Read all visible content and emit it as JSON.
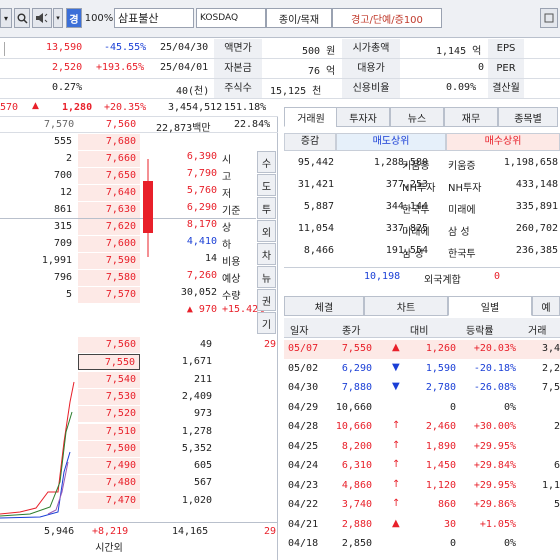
{
  "toolbar": {
    "search_icon": "search-icon",
    "sound_icon": "speaker-icon",
    "mode_label": "경",
    "pct_label": "100%",
    "stock_name": "삼표불산",
    "market": "KOSDAQ",
    "sector": "종이/목재",
    "warning": "경고/단예/증100"
  },
  "info": {
    "row1": {
      "val1": "13,590",
      "chg": "-45.55%",
      "date": "25/04/30",
      "label1": "액면가",
      "face": "500 원",
      "label2": "시가총액",
      "cap": "1,145 억",
      "label3": "EPS"
    },
    "row2": {
      "val1": "2,520",
      "chg": "+193.65%",
      "date": "25/04/01",
      "label1": "자본금",
      "face": "76 억",
      "label2": "대용가",
      "cap": "0",
      "label3": "PER"
    },
    "row3": {
      "val1": "0.27%",
      "date": "40(천)",
      "label1": "주식수",
      "face": "15,125 천",
      "label2": "신용비율",
      "cap": "0.09%",
      "label3": "결산월"
    }
  },
  "quote": {
    "prev": "570",
    "price": "1,280",
    "pct": "+20.35%",
    "volume": "3,454,512",
    "turnover": "151.18%"
  },
  "orderbook": {
    "header_left": "7,570",
    "header_price": "7,560",
    "amount": "22,873백만",
    "amount_pct": "22.84%",
    "sell": [
      {
        "qty": "555",
        "price": "7,680"
      },
      {
        "qty": "2",
        "price": "7,660"
      },
      {
        "qty": "700",
        "price": "7,650"
      },
      {
        "qty": "12",
        "price": "7,640"
      },
      {
        "qty": "861",
        "price": "7,630"
      },
      {
        "qty": "315",
        "price": "7,620"
      },
      {
        "qty": "709",
        "price": "7,600"
      },
      {
        "qty": "1,991",
        "price": "7,590"
      },
      {
        "qty": "796",
        "price": "7,580"
      },
      {
        "qty": "5",
        "price": "7,570"
      }
    ],
    "info_side": [
      {
        "val": "6,390",
        "lbl": "시"
      },
      {
        "val": "7,790",
        "lbl": "고"
      },
      {
        "val": "5,760",
        "lbl": "저"
      },
      {
        "val": "6,290",
        "lbl": "기준"
      },
      {
        "val": "8,170",
        "lbl": "상"
      },
      {
        "val": "4,410",
        "lbl": "하"
      },
      {
        "val": "14",
        "lbl": "비용"
      },
      {
        "val": "7,260",
        "lbl": "예상"
      },
      {
        "val": "30,052",
        "lbl": "수량"
      },
      {
        "val": "▲ 970",
        "lbl": "+15.42%"
      }
    ],
    "vtabs": [
      "수",
      "도",
      "투",
      "외",
      "차",
      "뉴",
      "권",
      "기"
    ],
    "buy": [
      {
        "price": "7,560",
        "qty": "49",
        "right": "29"
      },
      {
        "price": "7,550",
        "qty": "1,671",
        "right": ""
      },
      {
        "price": "7,540",
        "qty": "211",
        "right": ""
      },
      {
        "price": "7,530",
        "qty": "2,409",
        "right": ""
      },
      {
        "price": "7,520",
        "qty": "973",
        "right": ""
      },
      {
        "price": "7,510",
        "qty": "1,278",
        "right": ""
      },
      {
        "price": "7,500",
        "qty": "5,352",
        "right": ""
      },
      {
        "price": "7,490",
        "qty": "605",
        "right": ""
      },
      {
        "price": "7,480",
        "qty": "567",
        "right": ""
      },
      {
        "price": "7,470",
        "qty": "1,020",
        "right": ""
      }
    ],
    "foot": {
      "left": "5,946",
      "mid": "+8,219",
      "right": "14,165",
      "rr": "29",
      "label": "시간외"
    }
  },
  "right_tabs": [
    "거래원",
    "투자자",
    "뉴스",
    "재무",
    "종목별"
  ],
  "broker": {
    "head": [
      "증감",
      "매도상위",
      "매수상위"
    ],
    "rows": [
      {
        "chg": "95,442",
        "sv": "1,288,580",
        "sn": "키움증",
        "bn": "키움증",
        "bv": "1,198,658"
      },
      {
        "chg": "31,421",
        "sv": "377,253",
        "sn": "NH투자",
        "bn": "NH투자",
        "bv": "433,148"
      },
      {
        "chg": "5,887",
        "sv": "344,144",
        "sn": "한국투",
        "bn": "미래에",
        "bv": "335,891"
      },
      {
        "chg": "11,054",
        "sv": "337,825",
        "sn": "미래에",
        "bn": "삼 성",
        "bv": "260,702"
      },
      {
        "chg": "8,466",
        "sv": "191,554",
        "sn": "삼 성",
        "bn": "한국투",
        "bv": "236,385"
      }
    ],
    "foreign": {
      "val": "10,198",
      "label": "외국계합",
      "right": "0"
    }
  },
  "lower_tabs": [
    "체결",
    "차트",
    "일별",
    "예"
  ],
  "daily": {
    "head": [
      "일자",
      "종가",
      "대비",
      "등락률",
      "거래"
    ],
    "rows": [
      {
        "d": "05/07",
        "close": "7,550",
        "dir": "▲",
        "diff": "1,260",
        "rate": "+20.03%",
        "vol": "3,4",
        "color": "red",
        "hl": true
      },
      {
        "d": "05/02",
        "close": "6,290",
        "dir": "▼",
        "diff": "1,590",
        "rate": "-20.18%",
        "vol": "2,2",
        "color": "blue",
        "hl": false
      },
      {
        "d": "04/30",
        "close": "7,880",
        "dir": "▼",
        "diff": "2,780",
        "rate": "-26.08%",
        "vol": "7,5",
        "color": "blue",
        "hl": false
      },
      {
        "d": "04/29",
        "close": "10,660",
        "dir": "",
        "diff": "0",
        "rate": "0%",
        "vol": "",
        "color": "black",
        "hl": false
      },
      {
        "d": "04/28",
        "close": "10,660",
        "dir": "↑",
        "diff": "2,460",
        "rate": "+30.00%",
        "vol": "2",
        "color": "red",
        "hl": false
      },
      {
        "d": "04/25",
        "close": "8,200",
        "dir": "↑",
        "diff": "1,890",
        "rate": "+29.95%",
        "vol": "",
        "color": "red",
        "hl": false
      },
      {
        "d": "04/24",
        "close": "6,310",
        "dir": "↑",
        "diff": "1,450",
        "rate": "+29.84%",
        "vol": "6",
        "color": "red",
        "hl": false
      },
      {
        "d": "04/23",
        "close": "4,860",
        "dir": "↑",
        "diff": "1,120",
        "rate": "+29.95%",
        "vol": "1,1",
        "color": "red",
        "hl": false
      },
      {
        "d": "04/22",
        "close": "3,740",
        "dir": "↑",
        "diff": "860",
        "rate": "+29.86%",
        "vol": "5",
        "color": "red",
        "hl": false
      },
      {
        "d": "04/21",
        "close": "2,880",
        "dir": "▲",
        "diff": "30",
        "rate": "+1.05%",
        "vol": "",
        "color": "red",
        "hl": false
      },
      {
        "d": "04/18",
        "close": "2,850",
        "dir": "",
        "diff": "0",
        "rate": "0%",
        "vol": "",
        "color": "black",
        "hl": false
      }
    ]
  }
}
